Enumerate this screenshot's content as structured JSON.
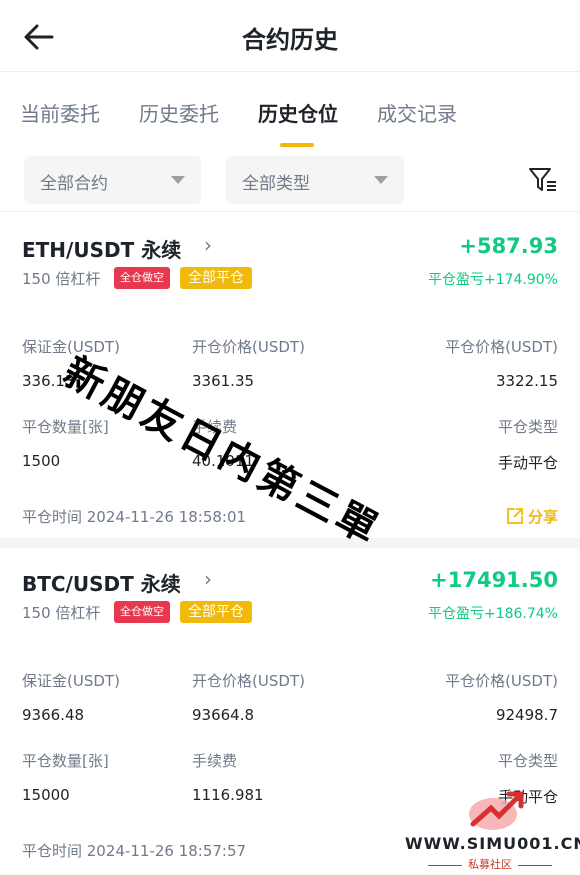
{
  "header": {
    "title": "合约历史"
  },
  "tabs": [
    "当前委托",
    "历史委托",
    "历史仓位",
    "成交记录"
  ],
  "filters": {
    "contract": "全部合约",
    "type": "全部类型"
  },
  "positions": [
    {
      "pair": "ETH/USDT 永续",
      "leverage": "150 倍杠杆",
      "tag_mode": "全仓做空",
      "tag_close": "全部平仓",
      "pnl": "+587.93",
      "pnl_ratio": "平仓盈亏+174.90%",
      "labels": {
        "margin": "保证金(USDT)",
        "open_price": "开仓价格(USDT)",
        "close_price": "平仓价格(USDT)",
        "close_qty": "平仓数量[张]",
        "fee": "手续费",
        "close_type": "平仓类型"
      },
      "margin": "336.13",
      "open_price": "3361.35",
      "close_price": "3322.15",
      "close_qty": "1500",
      "fee": "40.1011",
      "close_type": "手动平仓",
      "close_time": "平仓时间  2024-11-26 18:58:01",
      "share": "分享"
    },
    {
      "pair": "BTC/USDT 永续",
      "leverage": "150 倍杠杆",
      "tag_mode": "全仓做空",
      "tag_close": "全部平仓",
      "pnl": "+17491.50",
      "pnl_ratio": "平仓盈亏+186.74%",
      "labels": {
        "margin": "保证金(USDT)",
        "open_price": "开仓价格(USDT)",
        "close_price": "平仓价格(USDT)",
        "close_qty": "平仓数量[张]",
        "fee": "手续费",
        "close_type": "平仓类型"
      },
      "margin": "9366.48",
      "open_price": "93664.8",
      "close_price": "92498.7",
      "close_qty": "15000",
      "fee": "1116.981",
      "close_type": "手动平仓",
      "close_time": "平仓时间  2024-11-26 18:57:57"
    }
  ],
  "watermark": "新朋友日内第三單",
  "site": {
    "url": "WWW.SIMU001.CN",
    "subtitle": "私募社区"
  },
  "colors": {
    "accent": "#f0b90b",
    "profit": "#0ecb81",
    "tag_red": "#e8384f"
  }
}
